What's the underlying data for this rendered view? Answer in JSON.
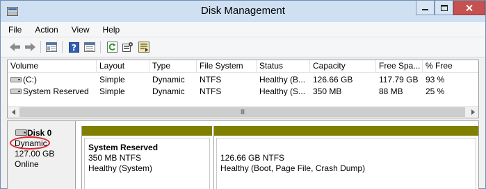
{
  "window": {
    "title": "Disk Management",
    "minimize_icon": "minimize-icon",
    "maximize_icon": "maximize-icon",
    "close_icon": "close-icon"
  },
  "menu": [
    "File",
    "Action",
    "View",
    "Help"
  ],
  "toolbar": {
    "icons": [
      "back-arrow-icon",
      "forward-arrow-icon",
      "console-tree-icon",
      "help-icon",
      "properties-icon",
      "refresh-icon",
      "settings-icon",
      "export-icon"
    ]
  },
  "volume_list": {
    "columns": [
      "Volume",
      "Layout",
      "Type",
      "File System",
      "Status",
      "Capacity",
      "Free Spa...",
      "% Free"
    ],
    "rows": [
      {
        "volume": "(C:)",
        "layout": "Simple",
        "type": "Dynamic",
        "fs": "NTFS",
        "status": "Healthy (B...",
        "capacity": "126.66 GB",
        "free": "117.79 GB",
        "pct": "93 %"
      },
      {
        "volume": "System Reserved",
        "layout": "Simple",
        "type": "Dynamic",
        "fs": "NTFS",
        "status": "Healthy (S...",
        "capacity": "350 MB",
        "free": "88 MB",
        "pct": "25 %"
      }
    ],
    "scroll_grip": "III"
  },
  "disk": {
    "name": "Disk 0",
    "type": "Dynamic",
    "size": "127.00 GB",
    "state": "Online",
    "partitions": [
      {
        "name": "System Reserved",
        "size_fs": "350 MB NTFS",
        "status": "Healthy (System)"
      },
      {
        "name": "",
        "size_fs": "126.66 GB NTFS",
        "status": "Healthy (Boot, Page File, Crash Dump)"
      }
    ]
  },
  "colors": {
    "titlebar": "#cfe0f2",
    "partition_bar": "#808000",
    "annotation_circle": "#e0202a",
    "close_button": "#c75050"
  }
}
